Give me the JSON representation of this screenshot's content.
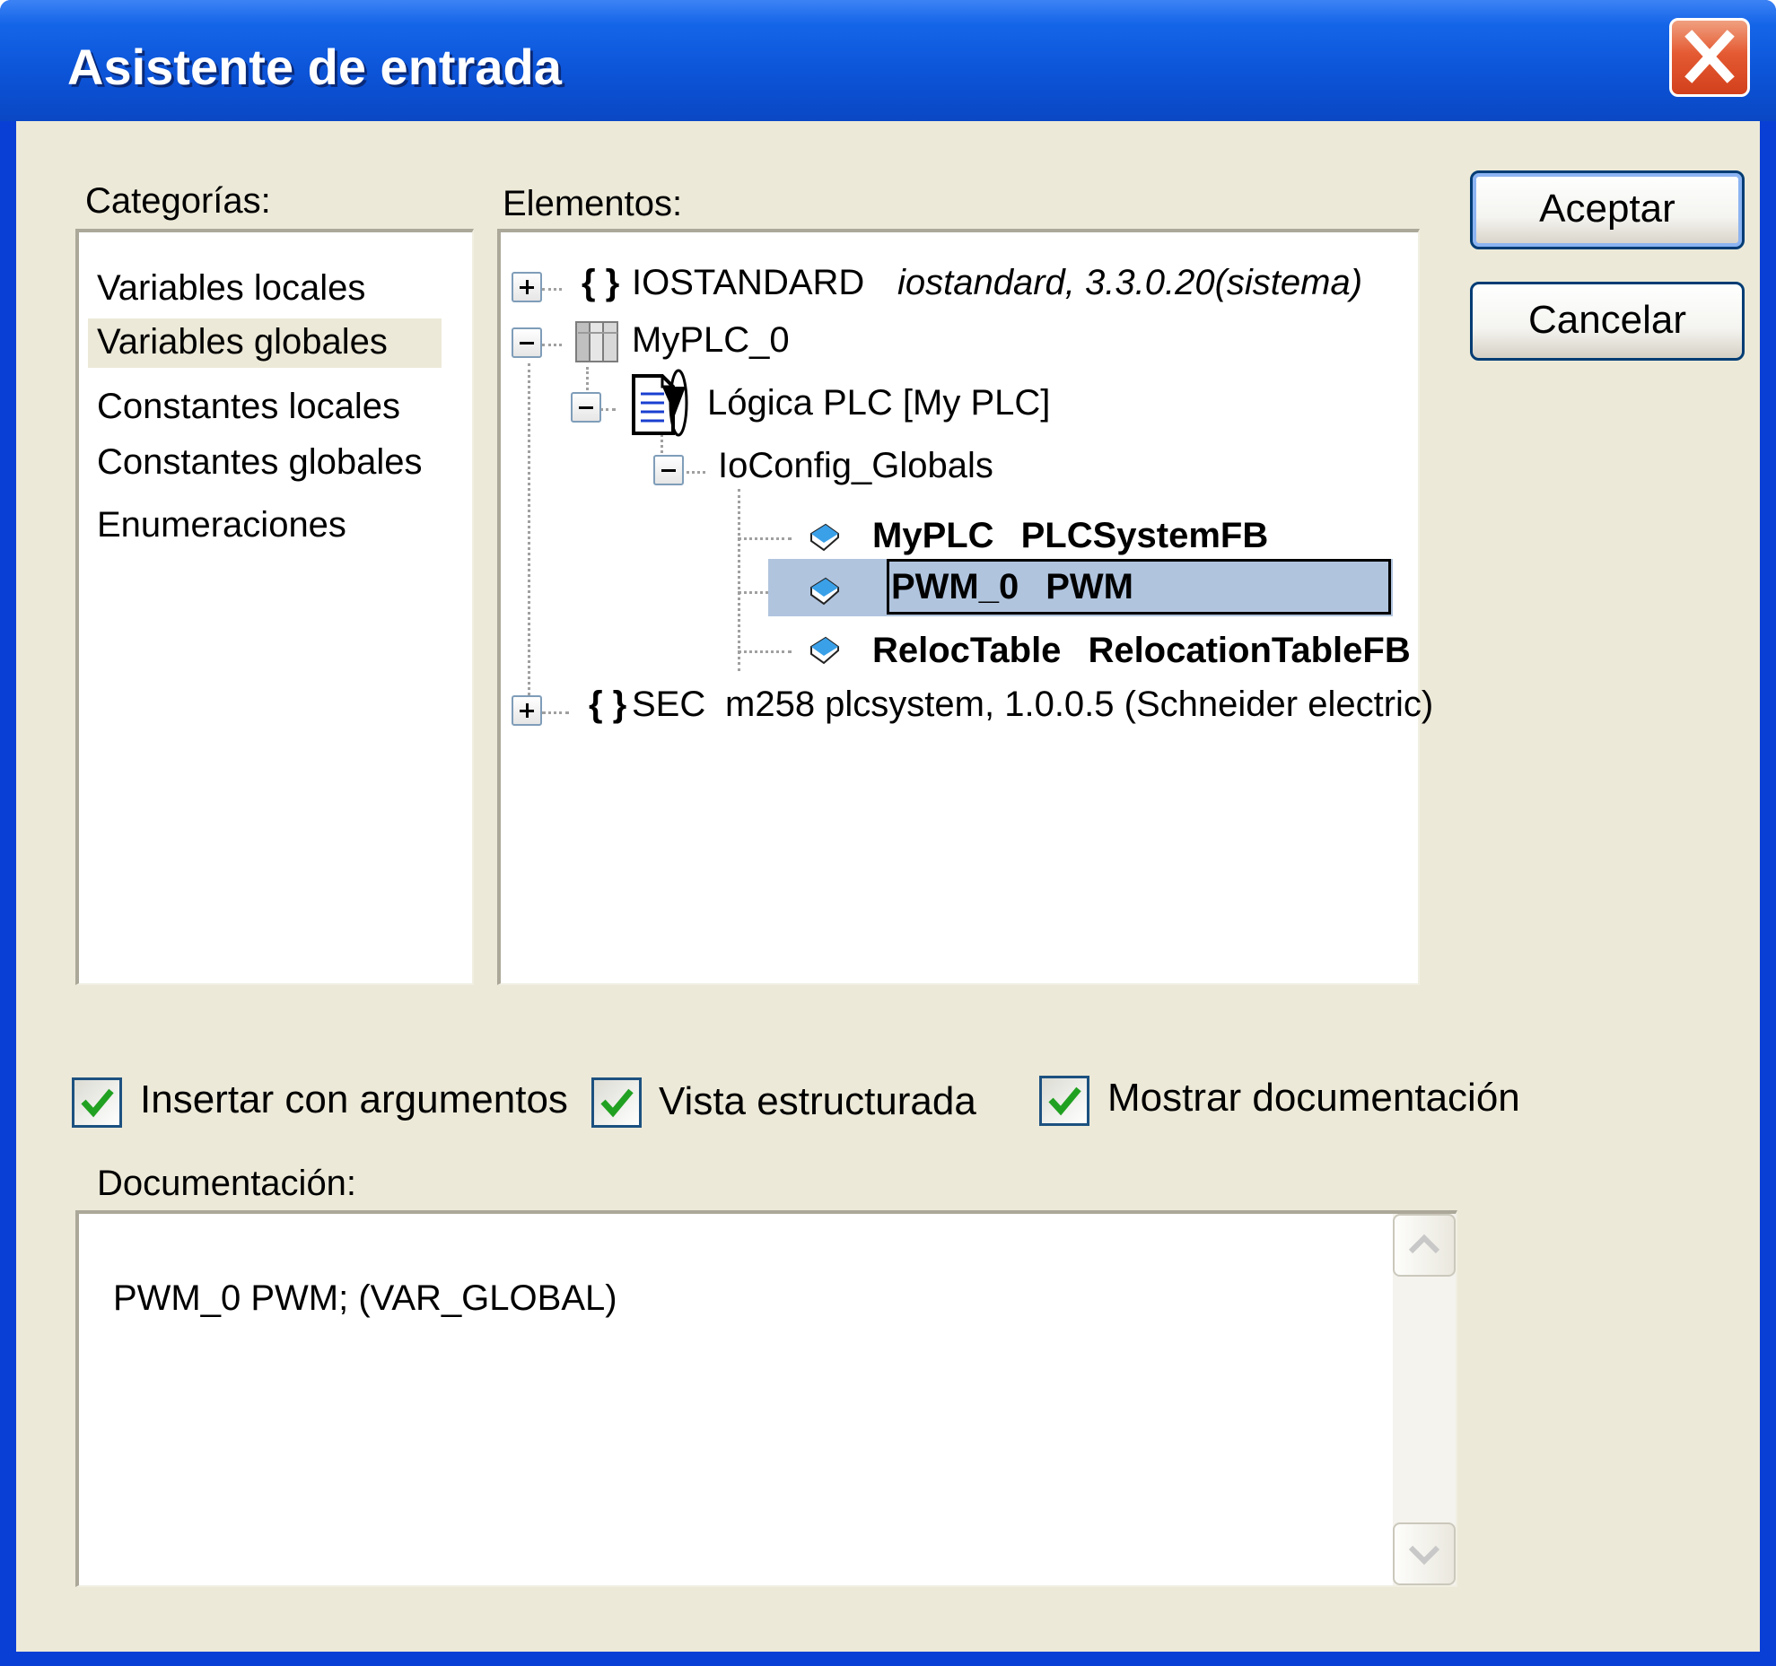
{
  "window": {
    "title": "Asistente de entrada"
  },
  "categories": {
    "label": "Categorías:",
    "items": [
      "Variables locales",
      "Variables globales",
      "Constantes locales",
      "Constantes globales",
      "Enumeraciones"
    ],
    "selected_index": 1
  },
  "elements": {
    "label": "Elementos:",
    "tree": {
      "iostandard": {
        "name": "IOSTANDARD",
        "info": "iostandard, 3.3.0.20(sistema)",
        "expander": "+"
      },
      "myplc": {
        "name": "MyPLC_0",
        "expander": "−"
      },
      "logic": {
        "name": "Lógica PLC [My PLC]",
        "expander": "−"
      },
      "ioconfig": {
        "name": "IoConfig_Globals",
        "expander": "−"
      },
      "vars": [
        {
          "name": "MyPLC",
          "type": "PLCSystemFB",
          "selected": false
        },
        {
          "name": "PWM_0",
          "type": "PWM",
          "selected": true
        },
        {
          "name": "RelocTable",
          "type": "RelocationTableFB",
          "selected": false
        }
      ],
      "sec": {
        "name": "SEC",
        "info": "m258 plcsystem, 1.0.0.5 (Schneider electric)",
        "expander": "+"
      },
      "braces": "{ }"
    }
  },
  "buttons": {
    "ok": "Aceptar",
    "cancel": "Cancelar"
  },
  "options": {
    "insert_args": {
      "label": "Insertar con argumentos",
      "checked": true
    },
    "structured_view": {
      "label": "Vista estructurada",
      "checked": true
    },
    "show_docs": {
      "label": "Mostrar documentación",
      "checked": true
    }
  },
  "documentation": {
    "label": "Documentación:",
    "text": "PWM_0 PWM; (VAR_GLOBAL)"
  },
  "colors": {
    "titlebar": "#0c54d8",
    "client": "#ece9d8",
    "selection": "#b0c4de",
    "check": "#21a121"
  }
}
